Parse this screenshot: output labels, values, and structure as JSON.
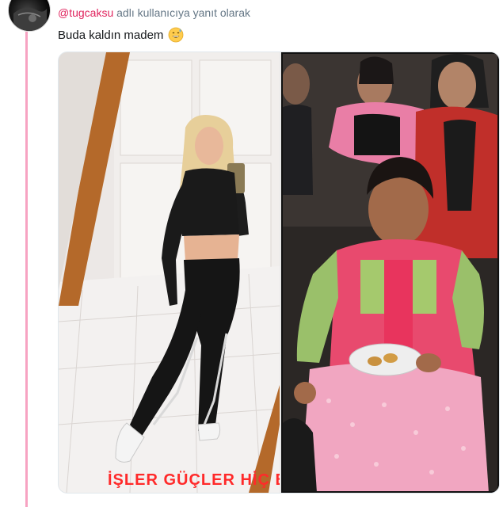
{
  "reply": {
    "mention": "@tugcaksu",
    "suffix": " adlı kullanıcıya yanıt olarak"
  },
  "tweet": {
    "text": "Buda kaldın madem",
    "emoji": "grinning-sweat-emoji"
  },
  "media": {
    "left_caption": "İŞLER GÜÇLER HİÇ BİTM"
  },
  "colors": {
    "mention": "#e0245e",
    "meta": "#657786",
    "thread_line": "#f7a3c2",
    "caption": "#ff2a2a"
  }
}
